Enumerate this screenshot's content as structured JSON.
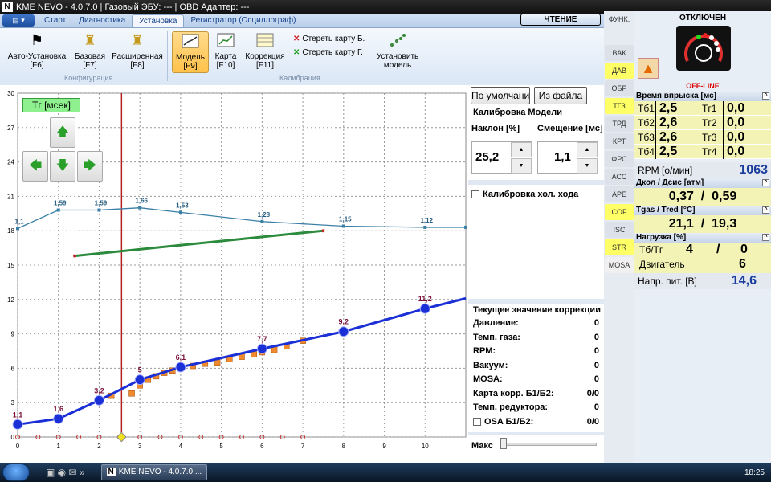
{
  "window": {
    "title": "KME NEVO - 4.0.7.0  |  Газовый ЭБУ: ---  |  OBD Адаптер: ---",
    "logo": "N"
  },
  "tabs": [
    "Старт",
    "Диагностика",
    "Установка",
    "Регистратор (Осциллограф)"
  ],
  "active_tab": "Установка",
  "read_button": "ЧТЕНИЕ",
  "ribbon": {
    "config": [
      {
        "label": "Авто-Установка",
        "key": "[F6]"
      },
      {
        "label": "Базовая",
        "key": "[F7]"
      },
      {
        "label": "Расширенная",
        "key": "[F8]"
      }
    ],
    "config_group": "Конфигурация",
    "calib": [
      {
        "label": "Модель",
        "key": "[F9]"
      },
      {
        "label": "Карта",
        "key": "[F10]"
      },
      {
        "label": "Коррекция",
        "key": "[F11]"
      }
    ],
    "erase_b": "Стереть карту Б.",
    "erase_g": "Стереть карту Г.",
    "set_model": "Установить",
    "set_model2": "модель",
    "calib_group": "Калибрация"
  },
  "chart_data": {
    "type": "line",
    "x_ticks": [
      0,
      1,
      2,
      3,
      4,
      5,
      6,
      7,
      8,
      9,
      10
    ],
    "y_ticks": [
      0,
      3,
      6,
      9,
      12,
      15,
      18,
      21,
      24,
      27,
      30
    ],
    "xlim": [
      0,
      11
    ],
    "ylim": [
      0,
      30
    ],
    "y_label_box": "Тг [мсек]",
    "upper_series": {
      "x": [
        0,
        1,
        2,
        3,
        4,
        6,
        8,
        10,
        11
      ],
      "y": [
        18.2,
        19.8,
        19.8,
        20,
        19.6,
        18.8,
        18.4,
        18.3,
        18.3
      ],
      "labels": [
        "1,1",
        "1,59",
        "1,59",
        "1,66",
        "1,53",
        "1,28",
        "1,15",
        "1,12"
      ]
    },
    "blue_series": {
      "x": [
        0,
        1,
        2,
        3,
        4,
        6,
        8,
        10,
        11
      ],
      "y": [
        1.1,
        1.6,
        3.2,
        5,
        6.1,
        7.7,
        9.2,
        11.2,
        12.1
      ],
      "labels": [
        "1,1",
        "1,6",
        "3,2",
        "5",
        "6,1",
        "7,7",
        "9,2",
        "11,2"
      ]
    },
    "green_line": {
      "x": [
        1.4,
        7.5
      ],
      "y": [
        15.8,
        18
      ]
    },
    "orange_points": {
      "x": [
        2,
        2.3,
        2.8,
        3,
        3.2,
        3.4,
        3.6,
        3.8,
        4,
        4.3,
        4.6,
        4.9,
        5.2,
        5.5,
        5.8,
        6,
        6.3,
        6.6,
        7
      ],
      "y": [
        3.3,
        3.6,
        3.8,
        4.5,
        5,
        5.3,
        5.6,
        5.8,
        6,
        6.2,
        6.4,
        6.5,
        6.8,
        7,
        7.2,
        7.4,
        7.6,
        7.9,
        8.4
      ]
    },
    "cursor_x": 2.55,
    "colors": {
      "upper": "#3a7fa6",
      "blue": "#1a2fd6",
      "green": "#2c8a3c",
      "orange": "#f08a2c",
      "cursor": "#b32020"
    }
  },
  "middle": {
    "default_btn": "По умолчанию",
    "file_btn": "Из файла",
    "model_title": "Калибровка Модели",
    "slope_label": "Наклон [%]",
    "offset_label": "Смещение [мс]",
    "slope": "25,2",
    "offset": "1,1",
    "idle_label": "Калибровка хол. хода",
    "corr_title": "Текущее значение коррекции",
    "corr": [
      {
        "k": "Давление:",
        "v": "0"
      },
      {
        "k": "Темп. газа:",
        "v": "0"
      },
      {
        "k": "RPM:",
        "v": "0"
      },
      {
        "k": "Вакуум:",
        "v": "0"
      },
      {
        "k": "MOSA:",
        "v": "0"
      },
      {
        "k": "Карта корр. Б1/Б2:",
        "v": "0/0"
      },
      {
        "k": "Темп. редуктора:",
        "v": "0"
      }
    ],
    "osa_label": "OSA Б1/Б2:",
    "osa_value": "0/0",
    "max_label": "Макс"
  },
  "sidebar_buttons": [
    "ФУНК.",
    "ВАК",
    "ДАВ",
    "ОБР",
    "ТГЗ",
    "ТРД",
    "КРТ",
    "ФРС",
    "АСС",
    "АРЕ",
    "COF",
    "ISC",
    "STR",
    "MOSA"
  ],
  "right": {
    "status": "ОТКЛЮЧЕН",
    "offline": "OFF-LINE",
    "inj_header": "Время впрыска [мс]",
    "inj": [
      {
        "a": "Тб1",
        "av": "2,5",
        "b": "Тг1",
        "bv": "0,0"
      },
      {
        "a": "Тб2",
        "av": "2,6",
        "b": "Тг2",
        "bv": "0,0"
      },
      {
        "a": "Тб3",
        "av": "2,6",
        "b": "Тг3",
        "bv": "0,0"
      },
      {
        "a": "Тб4",
        "av": "2,5",
        "b": "Тг4",
        "bv": "0,0"
      }
    ],
    "rpm_label": "RPM [о/мин]",
    "rpm": "1063",
    "press_header": "Дкол / Дсис [атм]",
    "press": "0,37  /  0,59",
    "temp_header": "Tgas / Tred [°C]",
    "temp": "21,1  /  19,3",
    "load_header": "Нагрузка [%]",
    "load_label": "Тб/Тг",
    "load_a": "4",
    "load_sep": "/",
    "load_b": "0",
    "engine_label": "Двигатель",
    "engine": "6",
    "volt_label": "Напр. пит. [В]",
    "volt": "14,6"
  },
  "taskbar": {
    "item": "KME NEVO - 4.0.7.0 ...",
    "clock": "18:25"
  }
}
